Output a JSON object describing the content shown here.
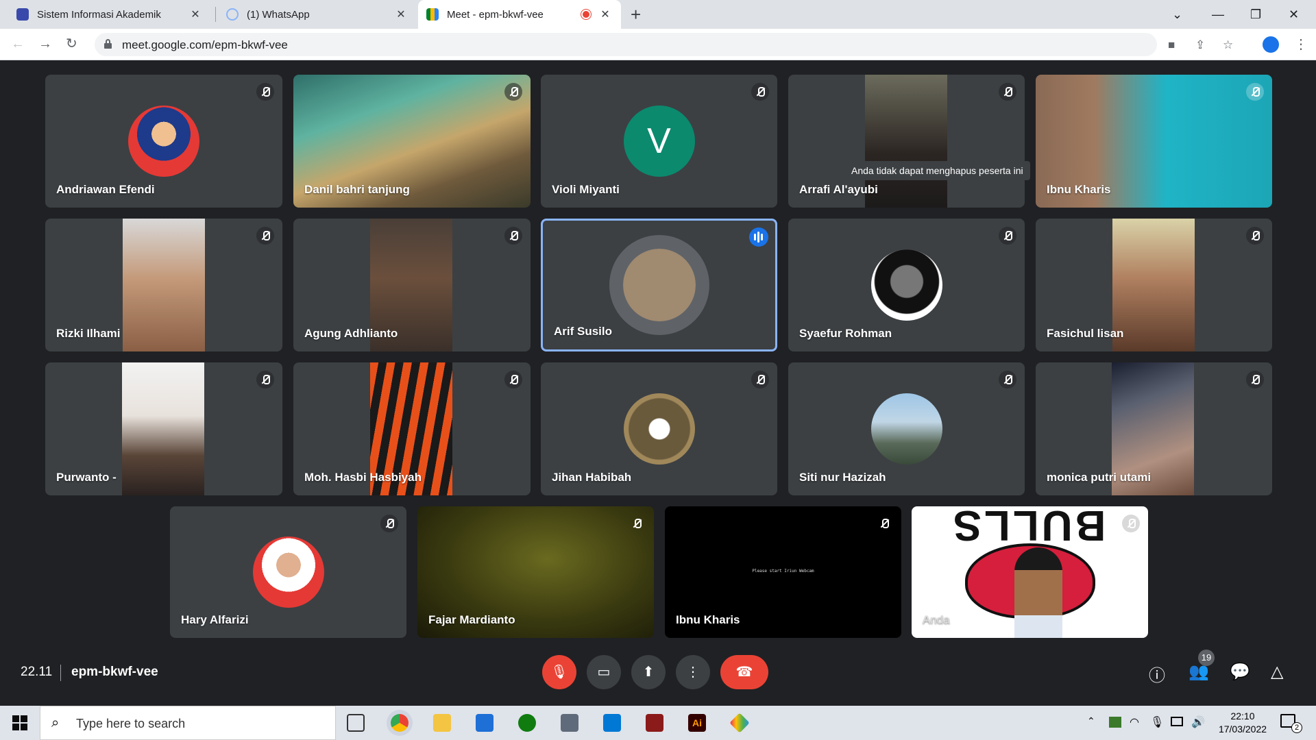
{
  "browser": {
    "tabs": [
      {
        "label": "Sistem Informasi Akademik",
        "close": "✕"
      },
      {
        "label": "(1) WhatsApp",
        "close": "✕"
      },
      {
        "label": "Meet - epm-bkwf-vee",
        "close": "✕"
      }
    ],
    "url": "meet.google.com/epm-bkwf-vee"
  },
  "tooltip": "Anda tidak dapat menghapus peserta ini",
  "participants": [
    {
      "name": "Andriawan Efendi"
    },
    {
      "name": "Danil bahri tanjung"
    },
    {
      "name": "Violi Miyanti",
      "initial": "V"
    },
    {
      "name": "Arrafi Al'ayubi"
    },
    {
      "name": "Ibnu Kharis"
    },
    {
      "name": "Rizki Ilhami"
    },
    {
      "name": "Agung Adhlianto"
    },
    {
      "name": "Arif Susilo"
    },
    {
      "name": "Syaefur Rohman"
    },
    {
      "name": "Fasichul lisan"
    },
    {
      "name": "Purwanto -"
    },
    {
      "name": "Moh. Hasbi Hasbiyah"
    },
    {
      "name": "Jihan Habibah"
    },
    {
      "name": "Siti nur Hazizah"
    },
    {
      "name": "monica putri utami"
    },
    {
      "name": "Hary Alfarizi"
    },
    {
      "name": "Fajar Mardianto"
    },
    {
      "name": "Ibnu Kharis",
      "screen_text": "Please start Iriun Webcam"
    },
    {
      "name": "Anda",
      "banner": "BULLS"
    }
  ],
  "meet": {
    "time": "22.11",
    "code": "epm-bkwf-vee",
    "people_count": "19"
  },
  "taskbar": {
    "search_placeholder": "Type here to search",
    "time": "22:10",
    "date": "17/03/2022",
    "notifications": "2"
  }
}
